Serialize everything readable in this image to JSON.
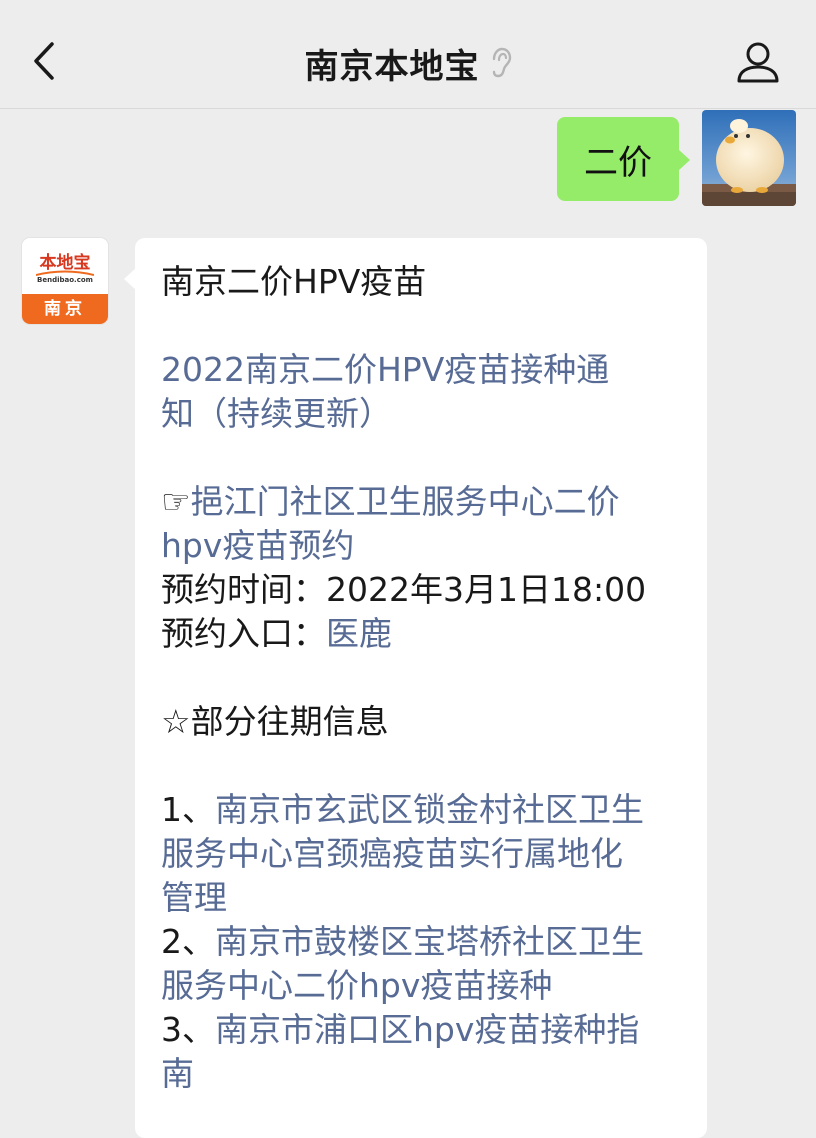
{
  "header": {
    "title": "南京本地宝"
  },
  "chat": {
    "self_message": "二价",
    "bot_avatar": {
      "logo_text": "本地宝",
      "logo_sub": "Bendibao.com",
      "city": "南京"
    },
    "reply": {
      "heading": "南京二价HPV疫苗",
      "notice_link_line1": "2022南京二价HPV疫苗接种通",
      "notice_link_line2": "知（持续更新）",
      "hand_icon": "☞",
      "center_link_line1": "挹江门社区卫生服务中心二价",
      "center_link_line2": "hpv疫苗预约",
      "time_line": "预约时间：2022年3月1日18:00",
      "entry_label": "预约入口：",
      "entry_link": "医鹿",
      "history_heading": "☆部分往期信息",
      "items": [
        {
          "num": "1、",
          "line1": "南京市玄武区锁金村社区卫生",
          "line2": "服务中心宫颈癌疫苗实行属地化",
          "line3": "管理"
        },
        {
          "num": "2、",
          "line1": "南京市鼓楼区宝塔桥社区卫生",
          "line2": "服务中心二价hpv疫苗接种"
        },
        {
          "num": "3、",
          "line1": "南京市浦口区hpv疫苗接种指",
          "line2": "南"
        }
      ]
    }
  },
  "colors": {
    "background": "#ededed",
    "self_bubble": "#95ec69",
    "link": "#576b95",
    "brand_orange": "#ef6a1e",
    "brand_red": "#d7381f"
  },
  "icons": [
    "back-chevron-icon",
    "ear-icon",
    "user-profile-icon",
    "duck-avatar-image",
    "bendibao-logo"
  ]
}
